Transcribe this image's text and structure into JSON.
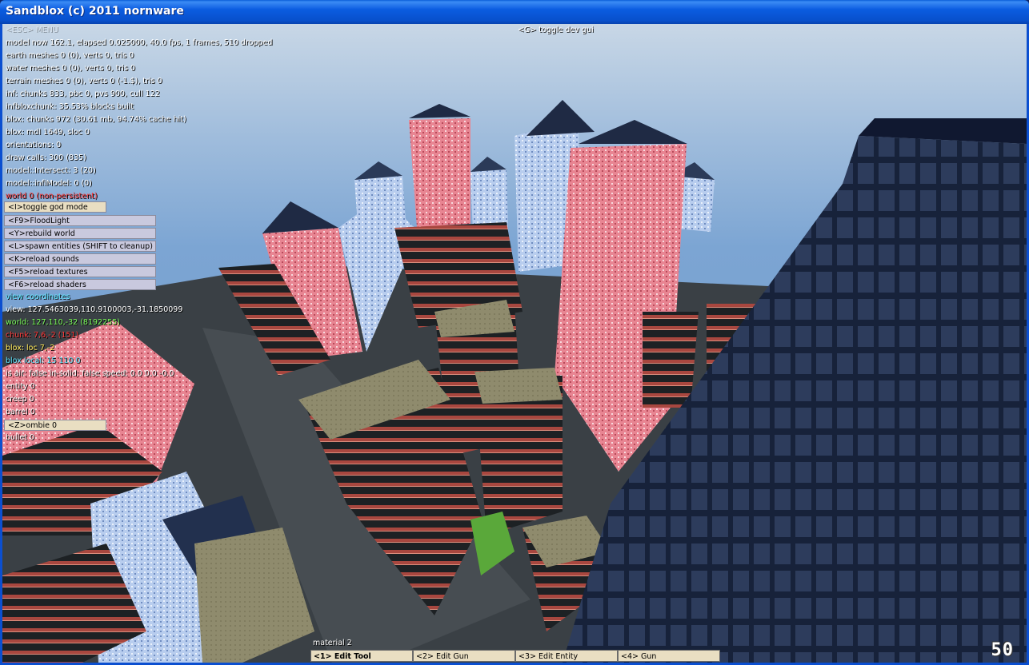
{
  "window": {
    "title": "Sandblox (c) 2011 nornware"
  },
  "header_hint": "<G> toggle dev gui",
  "menu_faded": "<ESC> MENU",
  "hud_lines": [
    {
      "text": "model now 162.1, elapsed 0.025000, 40.0 fps, 1 frames, 510 dropped",
      "color": "white"
    },
    {
      "text": "earth meshes 0 (0), verts 0, tris 0",
      "color": "white"
    },
    {
      "text": "water meshes 0 (0), verts 0, tris 0",
      "color": "white"
    },
    {
      "text": "terrain meshes 0 (0), verts 0 (-1.$), tris 0",
      "color": "white"
    },
    {
      "text": "inf: chunks 833, pbc 0, pvs 900, cull 122",
      "color": "white"
    },
    {
      "text": "infbloxchunk: 35.53% blocks built",
      "color": "white"
    },
    {
      "text": "blox: chunks 972 (30.61 mb, 94.74% cache hit)",
      "color": "white"
    },
    {
      "text": "blox: mdl 1649, sloc 0",
      "color": "white"
    },
    {
      "text": "orientations: 0",
      "color": "white"
    },
    {
      "text": "draw calls: 300 (835)",
      "color": "white"
    },
    {
      "text": "model::Intersect: 3 (20)",
      "color": "white"
    },
    {
      "text": "model::infiModel: 0 (0)",
      "color": "white"
    },
    {
      "text": "world 0 (non-persistent)",
      "color": "red"
    }
  ],
  "god_mode_button": "<I>toggle god mode",
  "action_buttons": [
    "<F9>FloodLight",
    "<Y>rebuild world",
    "<L>spawn entities (SHIFT to cleanup)",
    "<K>reload sounds",
    "<F5>reload textures",
    "<F6>reload shaders"
  ],
  "coord_lines": [
    {
      "text": "view coordinates",
      "color": "cyan"
    },
    {
      "text": "view: 127.5463039,110.9100003,-31.1850099",
      "color": "white"
    },
    {
      "text": "world: 127,110,-32 (8192255)",
      "color": "green"
    },
    {
      "text": "chunk: 7,6,-2 (151)",
      "color": "red"
    },
    {
      "text": "blox: loc 7,-2",
      "color": "yellow"
    },
    {
      "text": "blox local: 15 110 0",
      "color": "cyan"
    },
    {
      "text": "is air: false in-solid: false speed: 0.0 0.0 -0.0",
      "color": "white"
    },
    {
      "text": "entity 0",
      "color": "white"
    },
    {
      "text": "creep 0",
      "color": "white"
    },
    {
      "text": "barrel 0",
      "color": "white"
    }
  ],
  "zombie_button": "<Z>ombie 0",
  "bullet_line": "bullet 0",
  "material_label": "material 2",
  "tools": [
    "<1> Edit Tool",
    "<2> Edit Gun",
    "<3> Edit Entity",
    "<4> Gun"
  ],
  "fps_badge": "50",
  "colors": {
    "titlebar": "#0b5ce0",
    "button_tan": "#e9dec2",
    "button_lavender": "#c9c9de",
    "pink_building": "#e87d8c",
    "blue_building": "#b9cff0",
    "dark_building": "#1e2a44",
    "road": "#3c4246",
    "roof": "#8c8a6c"
  }
}
